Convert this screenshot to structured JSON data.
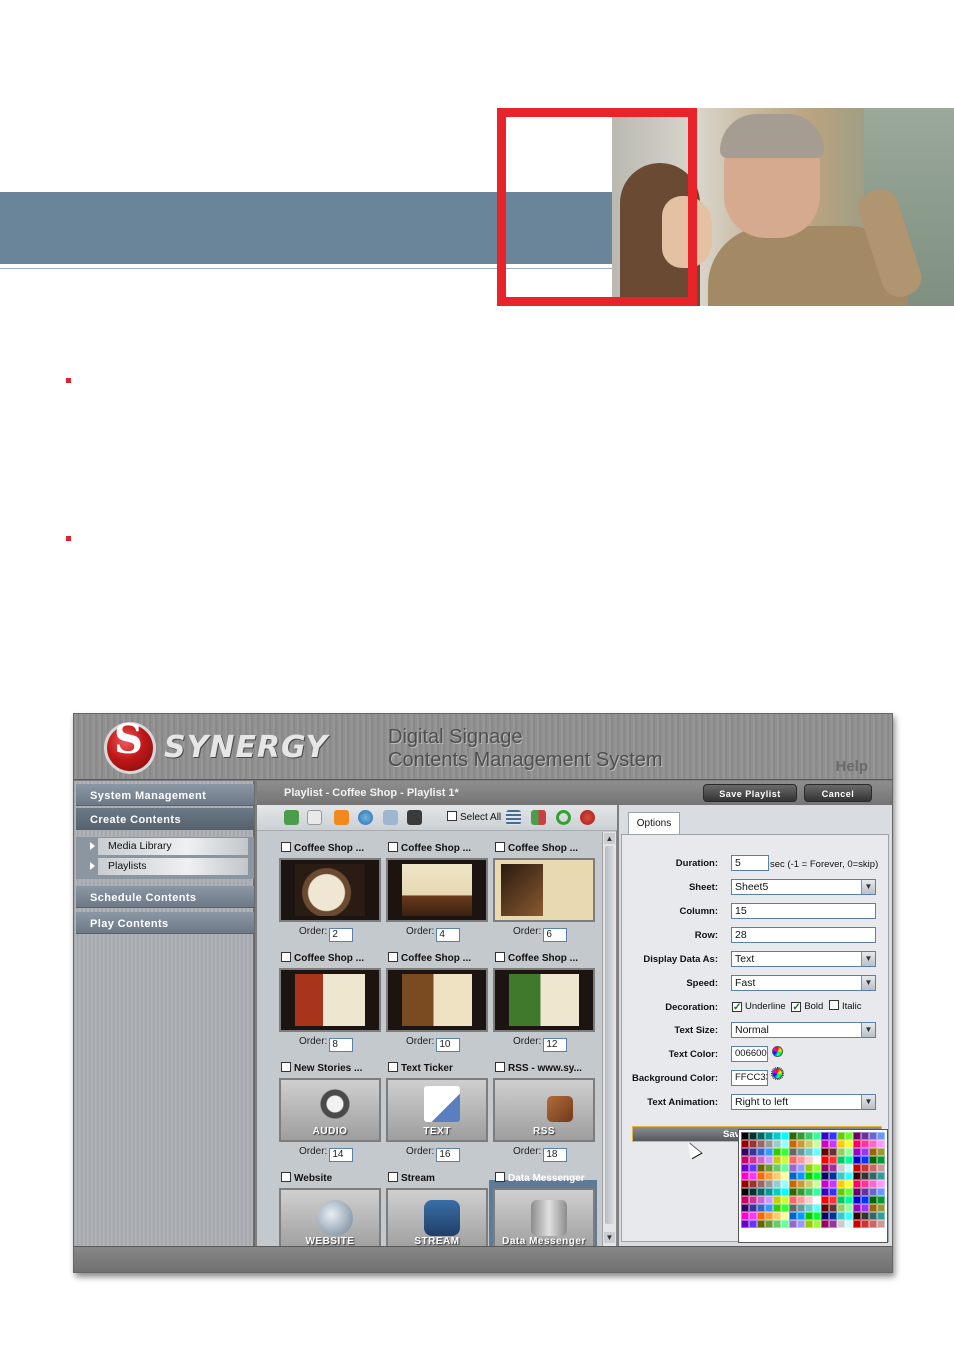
{
  "app": {
    "logo_text": "SYNERGY",
    "title_line1": "Digital Signage",
    "title_line2": "Contents Management System",
    "help": "Help"
  },
  "sidebar": {
    "items": [
      {
        "label": "System Management"
      },
      {
        "label": "Create Contents"
      },
      {
        "label": "Schedule Contents"
      },
      {
        "label": "Play Contents"
      }
    ],
    "sub_items": [
      {
        "label": "Media Library"
      },
      {
        "label": "Playlists"
      }
    ]
  },
  "playlist": {
    "title": "Playlist - Coffee Shop - Playlist 1*",
    "save_label": "Save Playlist",
    "cancel_label": "Cancel",
    "select_all": "Select All",
    "order_label": "Order:",
    "tiles": [
      {
        "name": "Coffee Shop ...",
        "order": "2"
      },
      {
        "name": "Coffee Shop ...",
        "order": "4"
      },
      {
        "name": "Coffee Shop ...",
        "order": "6"
      },
      {
        "name": "Coffee Shop ...",
        "order": "8"
      },
      {
        "name": "Coffee Shop ...",
        "order": "10"
      },
      {
        "name": "Coffee Shop ...",
        "order": "12"
      },
      {
        "name": "New Stories ...",
        "order": "14",
        "caption": "AUDIO"
      },
      {
        "name": "Text Ticker",
        "order": "16",
        "caption": "TEXT"
      },
      {
        "name": "RSS - www.sy...",
        "order": "18",
        "caption": "RSS"
      },
      {
        "name": "Website",
        "caption": "WEBSITE"
      },
      {
        "name": "Stream",
        "caption": "STREAM"
      },
      {
        "name": "Data Messenger",
        "caption": "Data Messenger"
      }
    ]
  },
  "options": {
    "tab": "Options",
    "duration_label": "Duration:",
    "duration_value": "5",
    "duration_hint": "sec (-1 = Forever, 0=skip)",
    "sheet_label": "Sheet:",
    "sheet_value": "Sheet5",
    "column_label": "Column:",
    "column_value": "15",
    "row_label": "Row:",
    "row_value": "28",
    "display_label": "Display Data As:",
    "display_value": "Text",
    "speed_label": "Speed:",
    "speed_value": "Fast",
    "decoration_label": "Decoration:",
    "underline": "Underline",
    "bold": "Bold",
    "italic": "Italic",
    "textsize_label": "Text Size:",
    "textsize_value": "Normal",
    "textcolor_label": "Text Color:",
    "textcolor_value": "006600",
    "bgcolor_label": "Background Color:",
    "bgcolor_value": "FFCC33",
    "animation_label": "Text Animation:",
    "animation_value": "Right to left",
    "save_label": "Save"
  },
  "colors": {
    "accent_red": "#e8232a",
    "banner_blue": "#6a8499"
  }
}
